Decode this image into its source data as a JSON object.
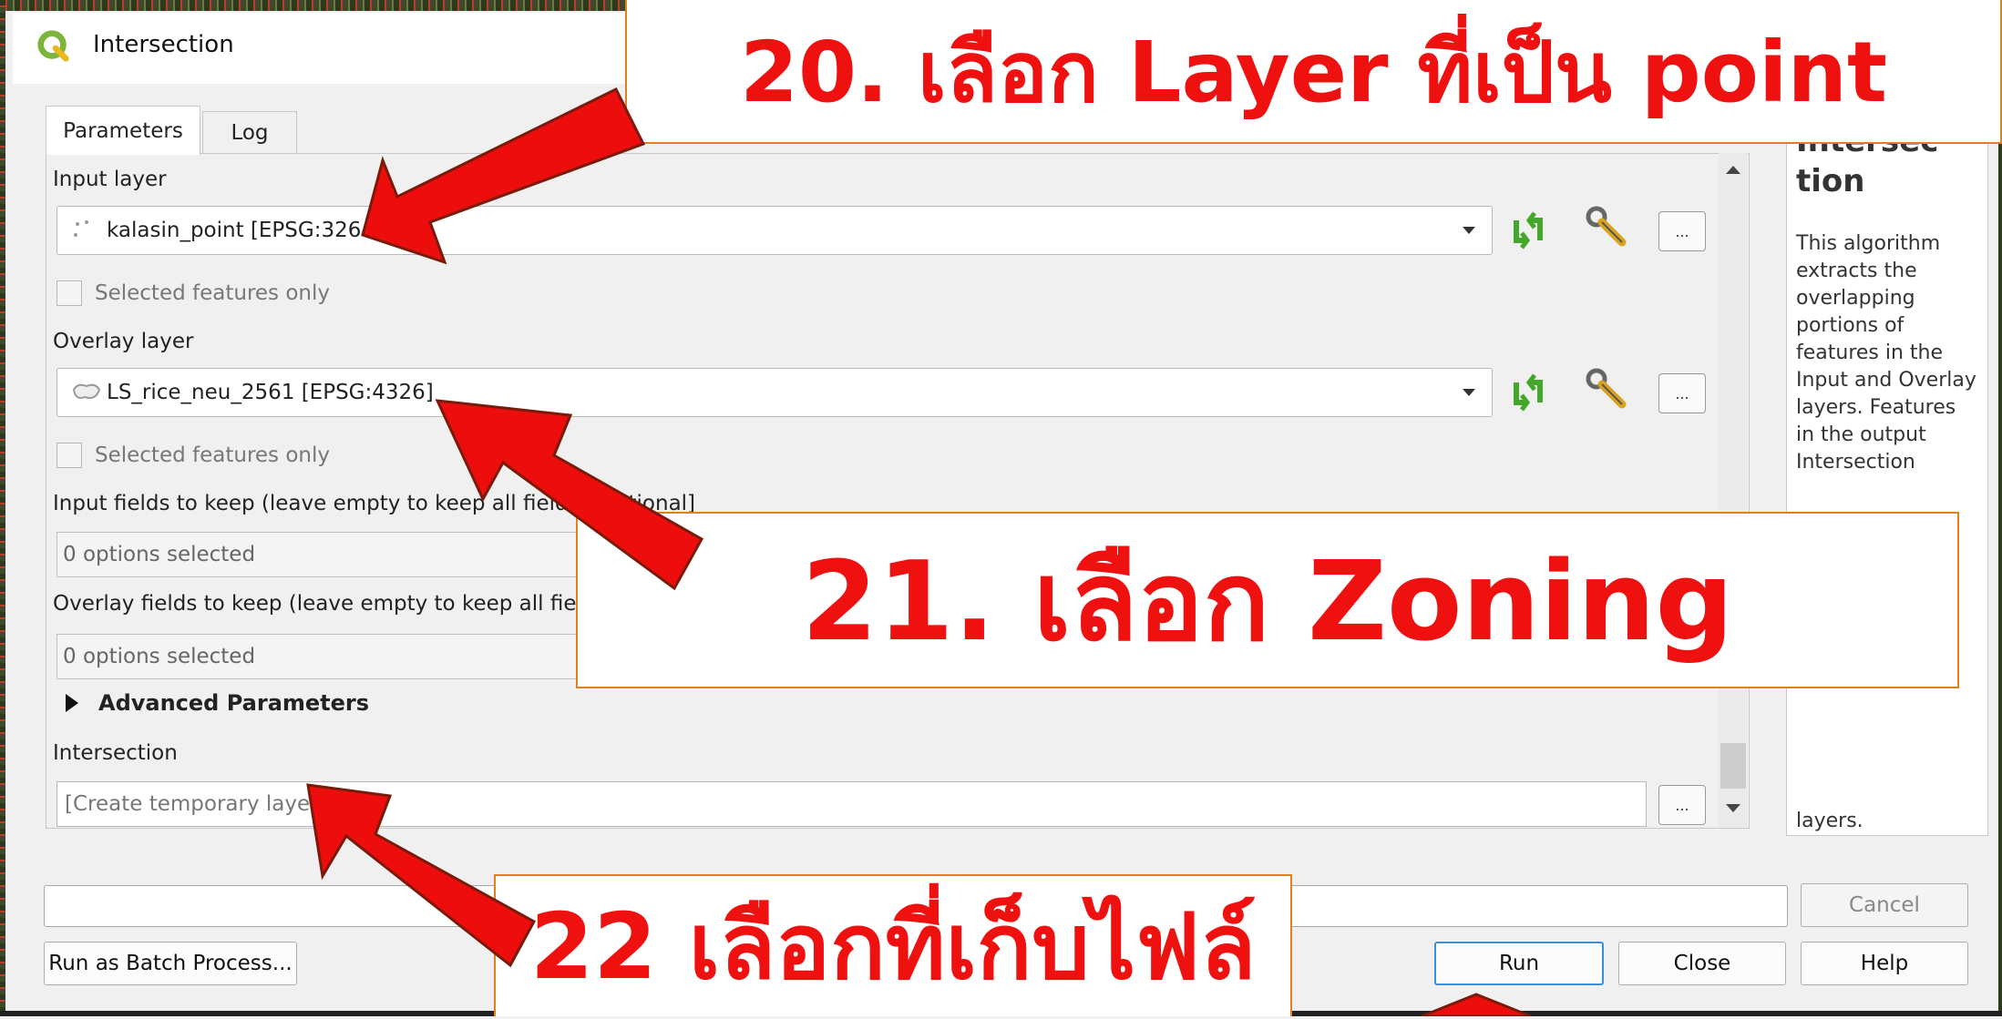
{
  "dialog": {
    "title": "Intersection",
    "tabs": [
      {
        "label": "Parameters",
        "active": true
      },
      {
        "label": "Log",
        "active": false
      }
    ]
  },
  "params": {
    "input_layer_label": "Input layer",
    "input_layer_value": "kalasin_point [EPSG:32648]",
    "input_selected_only": "Selected features only",
    "overlay_layer_label": "Overlay layer",
    "overlay_layer_value": "LS_rice_neu_2561 [EPSG:4326]",
    "overlay_selected_only": "Selected features only",
    "input_fields_label": "Input fields to keep (leave empty to keep all fields) [optional]",
    "input_fields_value": "0 options selected",
    "overlay_fields_label": "Overlay fields to keep (leave empty to keep all fields) [optional]",
    "overlay_fields_value": "0 options selected",
    "advanced_label": "Advanced Parameters",
    "output_label": "Intersection",
    "output_placeholder": "[Create temporary layer]",
    "dots": "..."
  },
  "help": {
    "heading_partial": "Intersec",
    "heading": "tion",
    "body": "This algorithm extracts the overlapping portions of features in the Input and Overlay layers. Features in the output Intersection",
    "tail": "layers."
  },
  "buttons": {
    "cancel": "Cancel",
    "batch": "Run as Batch Process...",
    "run": "Run",
    "close": "Close",
    "help": "Help"
  },
  "annotations": {
    "step20": "20. เลือก Layer ที่เป็น point",
    "step21": "21. เลือก Zoning",
    "step22": "22 เลือกที่เก็บไฟล์"
  },
  "colors": {
    "annotation_text": "#ef1010",
    "annotation_border": "#e08020",
    "arrow": "#ee0d0d",
    "qgis_green": "#7bb53b"
  }
}
